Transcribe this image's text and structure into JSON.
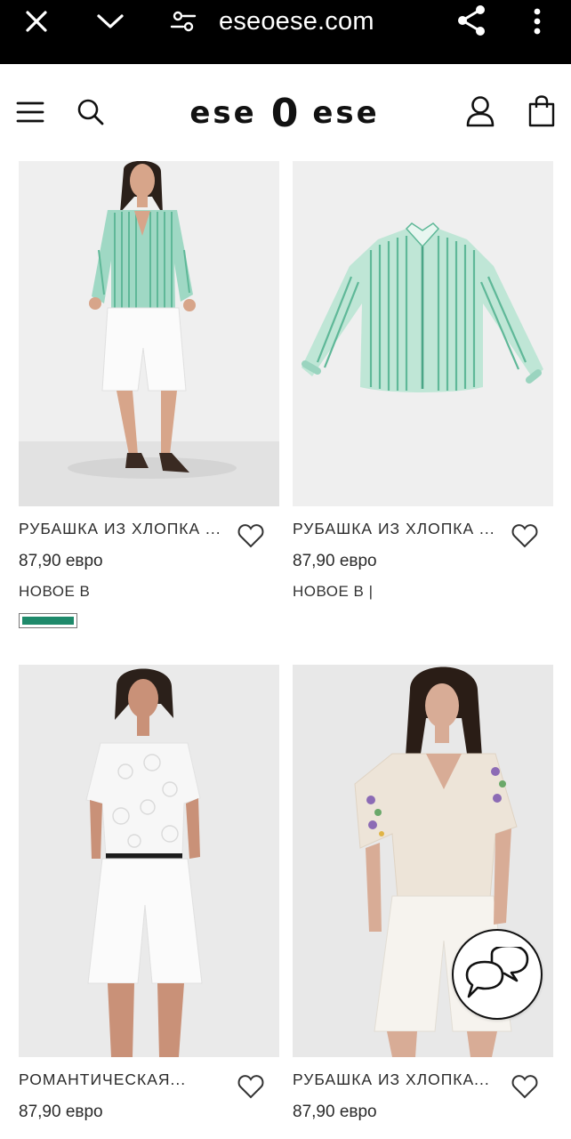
{
  "browser": {
    "url": "eseoese.com"
  },
  "site": {
    "logo_left": "ese",
    "logo_mid": "0",
    "logo_right": "ese"
  },
  "products": [
    {
      "name": "РУБАШКА ИЗ ХЛОПКА ...",
      "price": "87,90 евро",
      "badge": "НОВОЕ В",
      "swatch_color": "#1f8a6b",
      "image": "model-striped-shirt-white-shorts"
    },
    {
      "name": "РУБАШКА ИЗ ХЛОПКА ...",
      "price": "87,90 евро",
      "badge": "НОВОЕ В |",
      "image": "striped-shirt-flatlay"
    },
    {
      "name": "РОМАНТИЧЕСКАЯ...",
      "price": "87,90 евро",
      "image": "model-lace-top-white-shorts"
    },
    {
      "name": "РУБАШКА ИЗ ХЛОПКА...",
      "price": "87,90 евро",
      "image": "model-embroidered-blouse-white-shorts"
    }
  ],
  "colors": {
    "stripe_green": "#7fcfb3",
    "accent_swatch": "#1f8a6b"
  }
}
